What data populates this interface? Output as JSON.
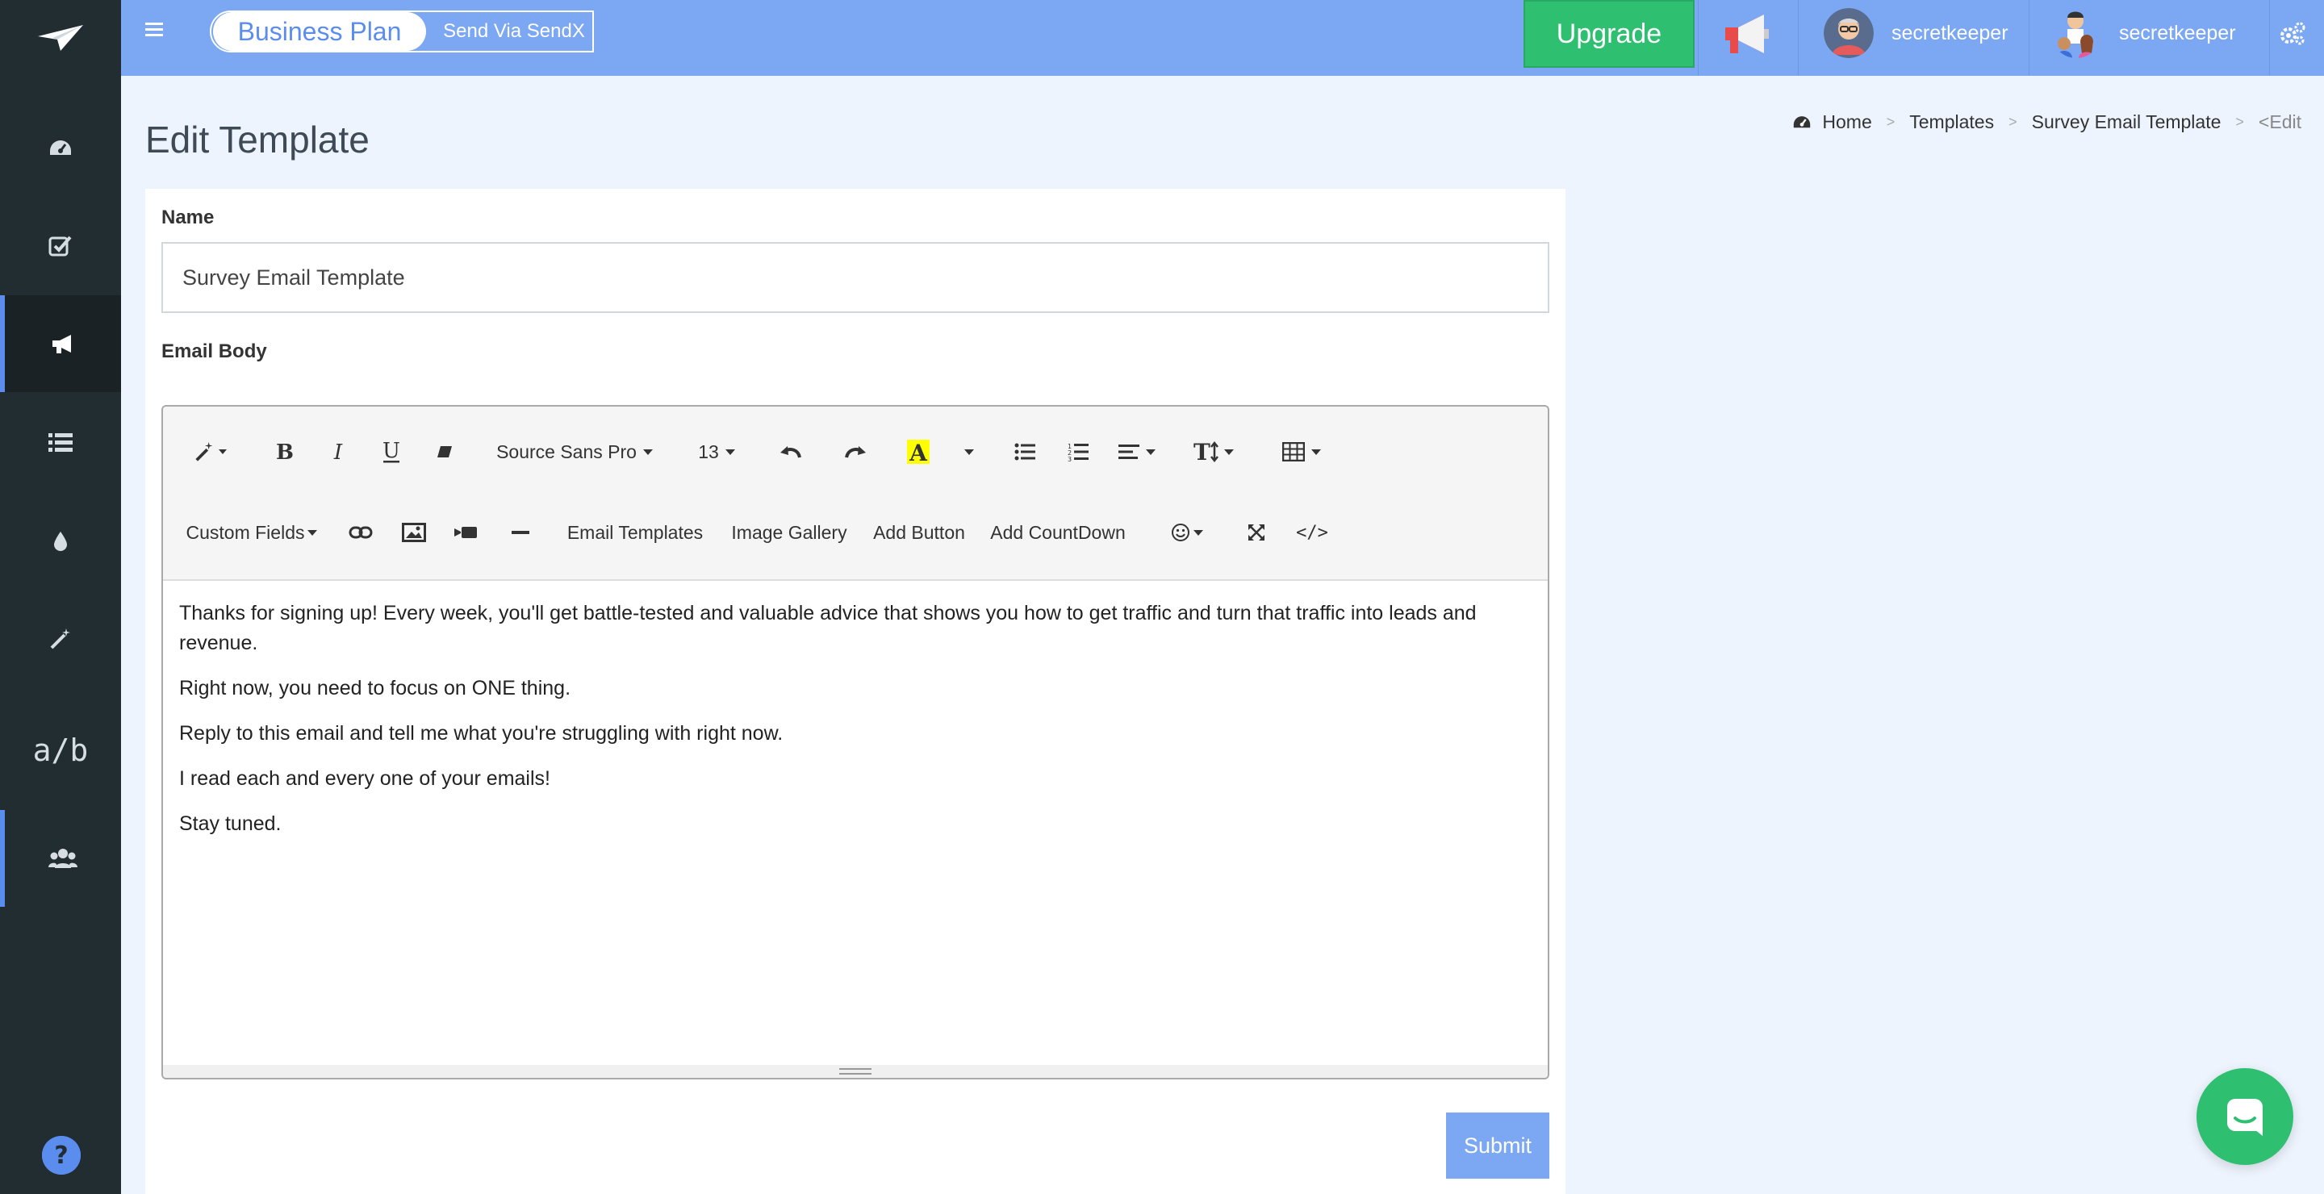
{
  "header": {
    "plan_name": "Business Plan",
    "send_via": "Send Via SendX",
    "upgrade_label": "Upgrade",
    "users": [
      {
        "name": "secretkeeper"
      },
      {
        "name": "secretkeeper"
      }
    ],
    "colors": {
      "topbar": "#7ba7f3",
      "upgrade": "#2fbf71",
      "sidebar": "#222d32"
    }
  },
  "sidebar": {
    "items": [
      {
        "icon": "dashboard-icon"
      },
      {
        "icon": "checkbox-icon"
      },
      {
        "icon": "megaphone-icon",
        "active": true
      },
      {
        "icon": "list-icon"
      },
      {
        "icon": "drop-icon"
      },
      {
        "icon": "magic-wand-icon"
      },
      {
        "label": "a/b"
      },
      {
        "icon": "users-icon"
      }
    ],
    "help_icon": "help-icon"
  },
  "page": {
    "title": "Edit Template",
    "breadcrumb": [
      "Home",
      "Templates",
      "Survey Email Template",
      "<Edit"
    ]
  },
  "form": {
    "name_label": "Name",
    "name_value": "Survey Email Template",
    "body_label": "Email Body",
    "submit_label": "Submit"
  },
  "toolbar": {
    "font_family": "Source Sans Pro",
    "font_size": "13",
    "custom_fields": "Custom Fields",
    "email_templates": "Email Templates",
    "image_gallery": "Image Gallery",
    "add_button": "Add Button",
    "add_countdown": "Add CountDown",
    "code_view": "</>",
    "highlight_letter": "A"
  },
  "email_body": {
    "paragraphs": [
      "Thanks for signing up! Every week, you'll get battle-tested and valuable advice that shows you how to get traffic and turn that traffic into leads and revenue.",
      "Right now, you need to focus on ONE thing.",
      "Reply to this email and tell me what you're struggling with right now.",
      "I read each and every one of your emails!",
      "Stay tuned."
    ]
  }
}
